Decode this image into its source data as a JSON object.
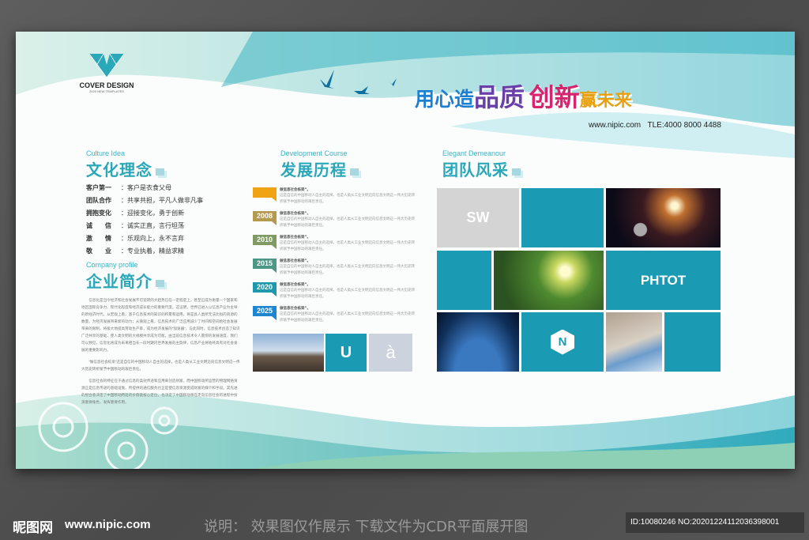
{
  "logo": {
    "title": "COVER DESIGN",
    "subtitle": "2020 NEW TEMPLATES"
  },
  "slogan": {
    "part1": "用心造",
    "part2": "品质",
    "part3": "创新",
    "part4": "赢未来",
    "website": "www.nipic.com",
    "phone": "TLE:4000 8000 4488"
  },
  "culture": {
    "en": "Culture Idea",
    "title": "文化理念",
    "items": [
      {
        "k": "客户第一",
        "v": "：客户是衣食父母"
      },
      {
        "k": "团队合作",
        "v": "：共享共担，平凡人做非凡事"
      },
      {
        "k": "拥抱变化",
        "v": "：迎接变化，勇于创新"
      },
      {
        "k": "诚　　信",
        "v": "：诚实正直，言行坦荡"
      },
      {
        "k": "激　　情",
        "v": "：乐观向上，永不言弃"
      },
      {
        "k": "敬　　业",
        "v": "：专业执着，精益求精"
      }
    ]
  },
  "profile": {
    "en": "Company profile",
    "title": "企业简介",
    "paragraphs": [
      "信息化是当今经济和社会发展不可逆转的大趋势已在一定程度上，甚至已成为衡量一个国家和地区国际竞争力、现代化程度和经济成长能力的重要尺度。这证明，世界已进入以信息产业为主导的新经济时代。从宏观上看，基于信息技术的知识的积累和运用，将是具人类所无法比拟的资源的数量，为经济发展带来新的动力；从微观上看，信息技术的广泛应用减少了时间和空间给社会发展带来的限制，将极大地提高劳动生产率，成为经济发展的“加速器”，与此同时，信息技术创造了知识广泛共享的基础，使人类文明的大规模共享成为可能。由当前信息技术令人震惊的发展速度，我们可以预见，信息化将成为未来相当长一段时期内世界发展的主旋律，信息产业将始终具有对社会发展的重要影响力。",
      "“做信息社会栋梁”这是自信的中国移动人自主的选择，也是人类从工业文明迈向信息文明这一伟大历史转折赋予中国移动的艰巨责任。",
      "信息社会的特征在于通过信息的高效传递和应用来创造财富，而中国移动所运营的物理网络资源正是信息传递的基础设施，所提供的通信服务也正是使信息资源变成财富的媒介和手段。其先进的觉合意决定了中国移动所处的价值链核心定位，也决定了中国移动将在走向信息社会的进程中扮演重要角色，发挥重要作用。"
    ]
  },
  "development": {
    "en": "Development Course",
    "title": "发展历程",
    "items": [
      {
        "year": "",
        "color": "#f0a413",
        "head": "做信息社会栋梁”。",
        "body": "这是自信的中国移动人自主的选择，也是人类从工业文明迈向信息文明这一伟大历史转折赋予中国移动的艰巨责任。"
      },
      {
        "year": "2008",
        "color": "#b49a4e",
        "head": "做信息社会栋梁”。",
        "body": "这是自信的中国移动人自主的选择，也是人类从工业文明迈向信息文明这一伟大历史转折赋予中国移动的艰巨责任。"
      },
      {
        "year": "2010",
        "color": "#7f9a62",
        "head": "做信息社会栋梁”。",
        "body": "这是自信的中国移动人自主的选择，也是人类从工业文明迈向信息文明这一伟大历史转折赋予中国移动的艰巨责任。"
      },
      {
        "year": "2015",
        "color": "#4e9786",
        "head": "做信息社会栋梁”。",
        "body": "这是自信的中国移动人自主的选择，也是人类从工业文明迈向信息文明这一伟大历史转折赋予中国移动的艰巨责任。"
      },
      {
        "year": "2020",
        "color": "#1e98ad",
        "head": "做信息社会栋梁”。",
        "body": "这是自信的中国移动人自主的选择，也是人类从工业文明迈向信息文明这一伟大历史转折赋予中国移动的艰巨责任。"
      },
      {
        "year": "2025",
        "color": "#1e86d0",
        "head": "做信息社会栋梁”。",
        "body": "这是自信的中国移动人自主的选择，也是人类从工业文明迈向信息文明这一伟大历史转折赋予中国移动的艰巨责任。"
      }
    ],
    "tiles": {
      "u": "U",
      "a": "à"
    }
  },
  "team": {
    "en": "Elegant Demeanour",
    "title": "团队风采",
    "tile_sw": "SW",
    "tile_photo": "PHTOT",
    "tile_logo": "N"
  },
  "footer": {
    "brand": "昵图网",
    "site": "www.nipic.com",
    "note": "说明： 效果图仅作展示  下载文件为CDR平面展开图",
    "id": "ID:10080246 NO:20201224112036398001"
  }
}
